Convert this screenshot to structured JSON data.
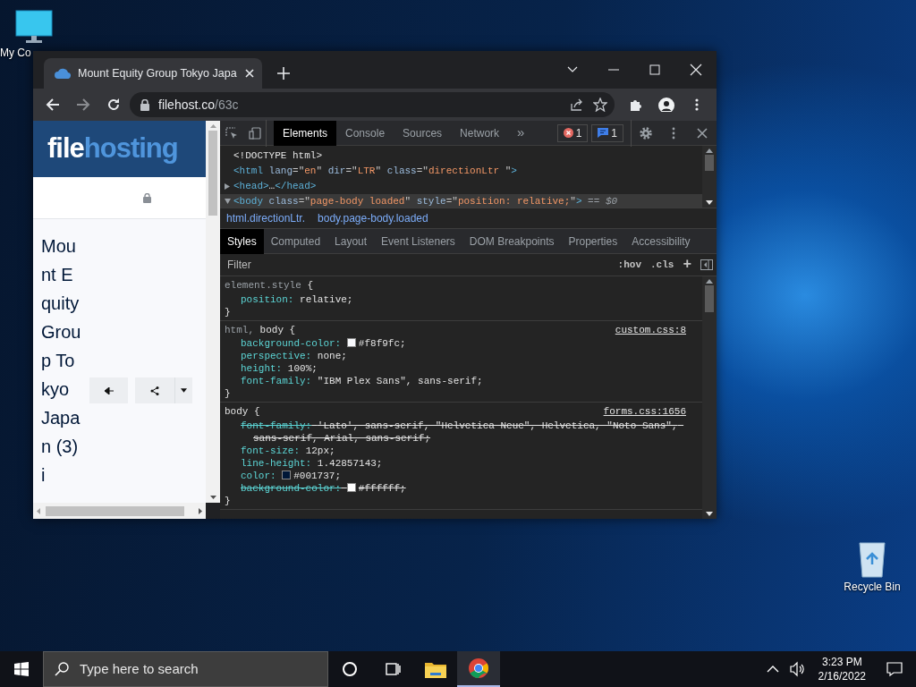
{
  "desktop_icons": [
    {
      "label": "My Co"
    },
    {
      "label": "Recycle Bin"
    }
  ],
  "browser": {
    "tab": {
      "title": "Mount Equity Group Tokyo Japa"
    },
    "url": {
      "host": "filehost.co",
      "path": "/63c"
    }
  },
  "page": {
    "logo": {
      "part_1": "file",
      "part_2": "hosting"
    },
    "title": "Mount Equity Group Tokyo Japan (3) i"
  },
  "devtools": {
    "tabs": [
      {
        "label": "Elements",
        "selected": true
      },
      {
        "label": "Console",
        "selected": false
      },
      {
        "label": "Sources",
        "selected": false
      },
      {
        "label": "Network",
        "selected": false
      }
    ],
    "more": "»",
    "errors": "1",
    "messages": "1",
    "dom": [
      {
        "tokens": [
          {
            "kind": "plain",
            "text": "<!DOCTYPE html>"
          }
        ]
      },
      {
        "tokens": [
          {
            "kind": "tag",
            "text": "<html"
          },
          {
            "kind": "attr",
            "text": " lang"
          },
          {
            "kind": "eq",
            "text": "=\""
          },
          {
            "kind": "val",
            "text": "en"
          },
          {
            "kind": "eq",
            "text": "\""
          },
          {
            "kind": "attr",
            "text": " dir"
          },
          {
            "kind": "eq",
            "text": "=\""
          },
          {
            "kind": "val",
            "text": "LTR"
          },
          {
            "kind": "eq",
            "text": "\""
          },
          {
            "kind": "attr",
            "text": " class"
          },
          {
            "kind": "eq",
            "text": "=\""
          },
          {
            "kind": "val",
            "text": "directionLtr "
          },
          {
            "kind": "eq",
            "text": "\""
          },
          {
            "kind": "tag",
            "text": ">"
          }
        ]
      },
      {
        "expanded": false,
        "tokens": [
          {
            "kind": "tag",
            "text": "<head>"
          },
          {
            "kind": "plain",
            "text": "…"
          },
          {
            "kind": "tag",
            "text": "</head>"
          }
        ]
      },
      {
        "expanded": true,
        "selected": true,
        "tokens": [
          {
            "kind": "tag",
            "text": "<body"
          },
          {
            "kind": "attr",
            "text": " class"
          },
          {
            "kind": "eq",
            "text": "=\""
          },
          {
            "kind": "val",
            "text": "page-body loaded"
          },
          {
            "kind": "eq",
            "text": "\""
          },
          {
            "kind": "attr",
            "text": " style"
          },
          {
            "kind": "eq",
            "text": "=\""
          },
          {
            "kind": "val",
            "text": "position: relative;"
          },
          {
            "kind": "eq",
            "text": "\""
          },
          {
            "kind": "tag",
            "text": ">"
          },
          {
            "kind": "ref",
            "text": " == $0"
          }
        ]
      }
    ],
    "breadcrumbs": [
      "html.directionLtr.",
      "body.page-body.loaded"
    ],
    "style_tabs": [
      {
        "label": "Styles",
        "selected": true
      },
      {
        "label": "Computed",
        "selected": false
      },
      {
        "label": "Layout",
        "selected": false
      },
      {
        "label": "Event Listeners",
        "selected": false
      },
      {
        "label": "DOM Breakpoints",
        "selected": false
      },
      {
        "label": "Properties",
        "selected": false
      },
      {
        "label": "Accessibility",
        "selected": false
      }
    ],
    "filter": {
      "placeholder": "Filter",
      "hov": ":hov",
      "cls": ".cls",
      "add": "+"
    },
    "rules": [
      {
        "selector": [
          {
            "text": "element.style",
            "matched": false
          },
          {
            "text": " {",
            "matched": true
          }
        ],
        "close": "}",
        "declarations": [
          {
            "text": "position: relative;",
            "overridden": false
          }
        ]
      },
      {
        "selector": [
          {
            "text": "html, ",
            "matched": false
          },
          {
            "text": "body {",
            "matched": true
          }
        ],
        "source": "custom.css:8",
        "close": "}",
        "declarations": [
          {
            "text": "background-color: #f8f9fc;",
            "color": "#f8f9fc",
            "overridden": false
          },
          {
            "text": "perspective: none;",
            "overridden": false
          },
          {
            "text": "height: 100%;",
            "overridden": false
          },
          {
            "text": "font-family: \"IBM Plex Sans\", sans-serif;",
            "overridden": false
          }
        ]
      },
      {
        "selector": [
          {
            "text": "body {",
            "matched": true
          }
        ],
        "source": "forms.css:1656",
        "close": "}",
        "declarations": [
          {
            "text": "font-family: 'Lato', sans-serif, \"Helvetica Neue\", Helvetica, \"Noto Sans\", sans-serif, Arial, sans-serif;",
            "overridden": true
          },
          {
            "text": "font-size: 12px;",
            "overridden": false
          },
          {
            "text": "line-height: 1.42857143;",
            "overridden": false
          },
          {
            "text": "color: #001737;",
            "color": "#001737",
            "overridden": false
          },
          {
            "text": "background-color: #ffffff;",
            "color": "#ffffff",
            "overridden": true
          }
        ]
      }
    ]
  },
  "taskbar": {
    "search": {
      "placeholder": "Type here to search"
    },
    "time": "3:23 PM",
    "date": "2/16/2022"
  }
}
